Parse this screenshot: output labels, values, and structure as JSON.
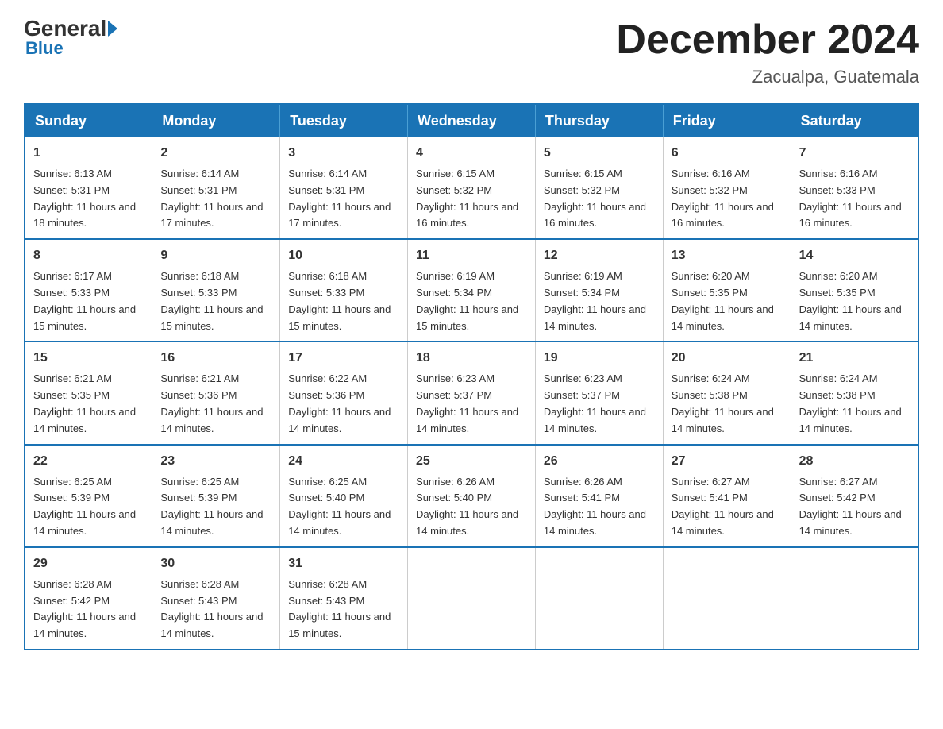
{
  "header": {
    "logo_general": "General",
    "logo_blue": "Blue",
    "month_title": "December 2024",
    "location": "Zacualpa, Guatemala"
  },
  "days_of_week": [
    "Sunday",
    "Monday",
    "Tuesday",
    "Wednesday",
    "Thursday",
    "Friday",
    "Saturday"
  ],
  "weeks": [
    [
      {
        "day": "1",
        "sunrise": "6:13 AM",
        "sunset": "5:31 PM",
        "daylight": "11 hours and 18 minutes."
      },
      {
        "day": "2",
        "sunrise": "6:14 AM",
        "sunset": "5:31 PM",
        "daylight": "11 hours and 17 minutes."
      },
      {
        "day": "3",
        "sunrise": "6:14 AM",
        "sunset": "5:31 PM",
        "daylight": "11 hours and 17 minutes."
      },
      {
        "day": "4",
        "sunrise": "6:15 AM",
        "sunset": "5:32 PM",
        "daylight": "11 hours and 16 minutes."
      },
      {
        "day": "5",
        "sunrise": "6:15 AM",
        "sunset": "5:32 PM",
        "daylight": "11 hours and 16 minutes."
      },
      {
        "day": "6",
        "sunrise": "6:16 AM",
        "sunset": "5:32 PM",
        "daylight": "11 hours and 16 minutes."
      },
      {
        "day": "7",
        "sunrise": "6:16 AM",
        "sunset": "5:33 PM",
        "daylight": "11 hours and 16 minutes."
      }
    ],
    [
      {
        "day": "8",
        "sunrise": "6:17 AM",
        "sunset": "5:33 PM",
        "daylight": "11 hours and 15 minutes."
      },
      {
        "day": "9",
        "sunrise": "6:18 AM",
        "sunset": "5:33 PM",
        "daylight": "11 hours and 15 minutes."
      },
      {
        "day": "10",
        "sunrise": "6:18 AM",
        "sunset": "5:33 PM",
        "daylight": "11 hours and 15 minutes."
      },
      {
        "day": "11",
        "sunrise": "6:19 AM",
        "sunset": "5:34 PM",
        "daylight": "11 hours and 15 minutes."
      },
      {
        "day": "12",
        "sunrise": "6:19 AM",
        "sunset": "5:34 PM",
        "daylight": "11 hours and 14 minutes."
      },
      {
        "day": "13",
        "sunrise": "6:20 AM",
        "sunset": "5:35 PM",
        "daylight": "11 hours and 14 minutes."
      },
      {
        "day": "14",
        "sunrise": "6:20 AM",
        "sunset": "5:35 PM",
        "daylight": "11 hours and 14 minutes."
      }
    ],
    [
      {
        "day": "15",
        "sunrise": "6:21 AM",
        "sunset": "5:35 PM",
        "daylight": "11 hours and 14 minutes."
      },
      {
        "day": "16",
        "sunrise": "6:21 AM",
        "sunset": "5:36 PM",
        "daylight": "11 hours and 14 minutes."
      },
      {
        "day": "17",
        "sunrise": "6:22 AM",
        "sunset": "5:36 PM",
        "daylight": "11 hours and 14 minutes."
      },
      {
        "day": "18",
        "sunrise": "6:23 AM",
        "sunset": "5:37 PM",
        "daylight": "11 hours and 14 minutes."
      },
      {
        "day": "19",
        "sunrise": "6:23 AM",
        "sunset": "5:37 PM",
        "daylight": "11 hours and 14 minutes."
      },
      {
        "day": "20",
        "sunrise": "6:24 AM",
        "sunset": "5:38 PM",
        "daylight": "11 hours and 14 minutes."
      },
      {
        "day": "21",
        "sunrise": "6:24 AM",
        "sunset": "5:38 PM",
        "daylight": "11 hours and 14 minutes."
      }
    ],
    [
      {
        "day": "22",
        "sunrise": "6:25 AM",
        "sunset": "5:39 PM",
        "daylight": "11 hours and 14 minutes."
      },
      {
        "day": "23",
        "sunrise": "6:25 AM",
        "sunset": "5:39 PM",
        "daylight": "11 hours and 14 minutes."
      },
      {
        "day": "24",
        "sunrise": "6:25 AM",
        "sunset": "5:40 PM",
        "daylight": "11 hours and 14 minutes."
      },
      {
        "day": "25",
        "sunrise": "6:26 AM",
        "sunset": "5:40 PM",
        "daylight": "11 hours and 14 minutes."
      },
      {
        "day": "26",
        "sunrise": "6:26 AM",
        "sunset": "5:41 PM",
        "daylight": "11 hours and 14 minutes."
      },
      {
        "day": "27",
        "sunrise": "6:27 AM",
        "sunset": "5:41 PM",
        "daylight": "11 hours and 14 minutes."
      },
      {
        "day": "28",
        "sunrise": "6:27 AM",
        "sunset": "5:42 PM",
        "daylight": "11 hours and 14 minutes."
      }
    ],
    [
      {
        "day": "29",
        "sunrise": "6:28 AM",
        "sunset": "5:42 PM",
        "daylight": "11 hours and 14 minutes."
      },
      {
        "day": "30",
        "sunrise": "6:28 AM",
        "sunset": "5:43 PM",
        "daylight": "11 hours and 14 minutes."
      },
      {
        "day": "31",
        "sunrise": "6:28 AM",
        "sunset": "5:43 PM",
        "daylight": "11 hours and 15 minutes."
      },
      null,
      null,
      null,
      null
    ]
  ],
  "labels": {
    "sunrise": "Sunrise:",
    "sunset": "Sunset:",
    "daylight": "Daylight:"
  }
}
